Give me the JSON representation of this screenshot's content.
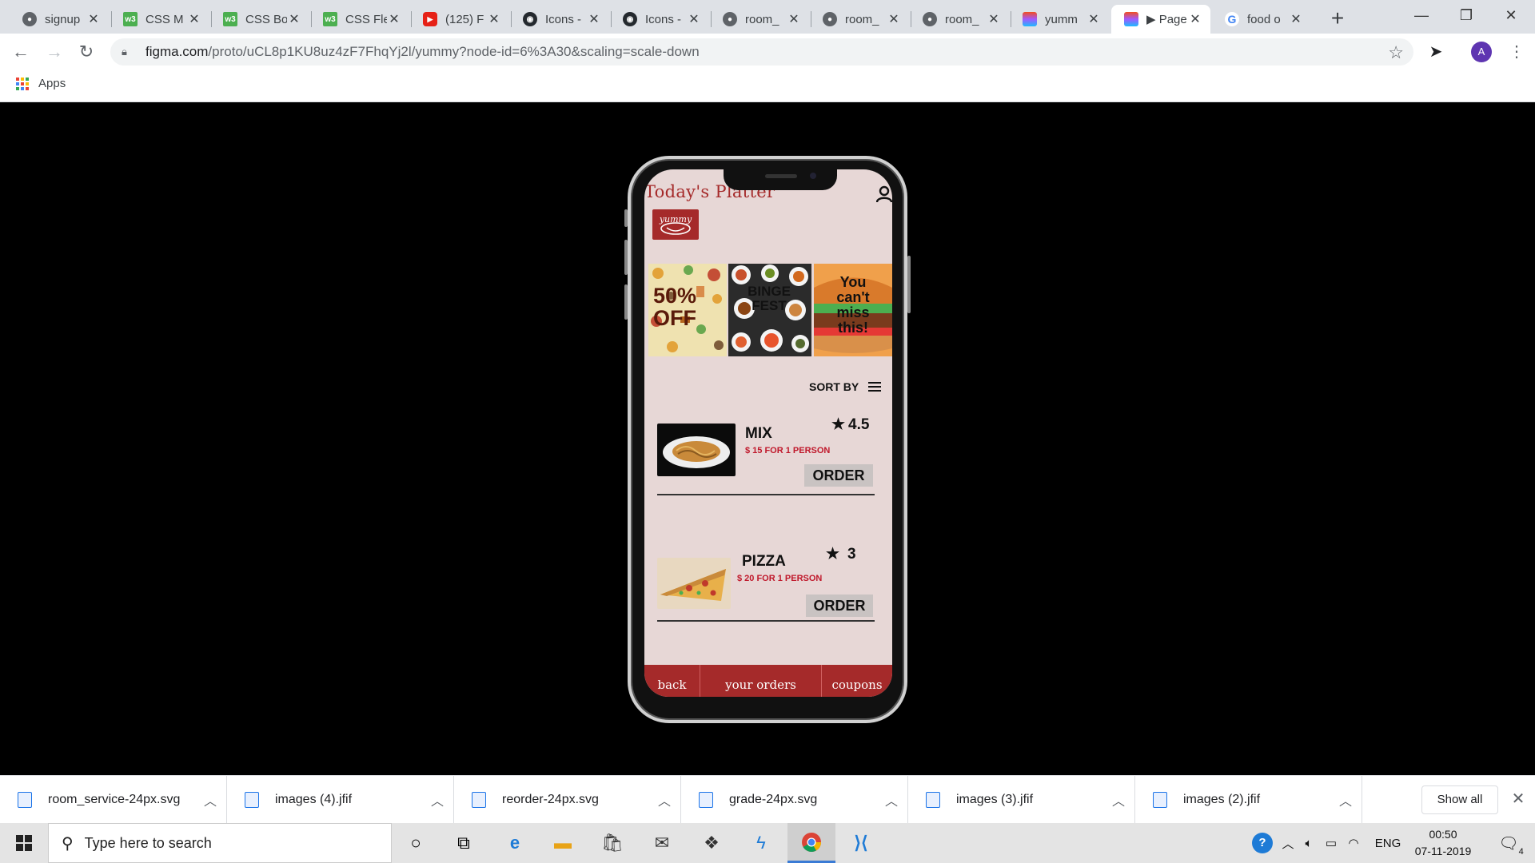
{
  "browser": {
    "tabs": [
      {
        "title": "signup",
        "icon": "globe-icon",
        "active": false
      },
      {
        "title": "CSS M",
        "icon": "w3schools-icon",
        "active": false
      },
      {
        "title": "CSS Bo",
        "icon": "w3schools-icon",
        "active": false
      },
      {
        "title": "CSS Fle",
        "icon": "w3schools-icon",
        "active": false
      },
      {
        "title": "(125) F",
        "icon": "youtube-icon",
        "active": false
      },
      {
        "title": "Icons -",
        "icon": "github-icon",
        "active": false
      },
      {
        "title": "Icons -",
        "icon": "github-icon",
        "active": false
      },
      {
        "title": "room_",
        "icon": "globe-icon",
        "active": false
      },
      {
        "title": "room_",
        "icon": "globe-icon",
        "active": false
      },
      {
        "title": "room_",
        "icon": "globe-icon",
        "active": false
      },
      {
        "title": "yumm",
        "icon": "figma-icon",
        "active": false
      },
      {
        "title": "▶ Page",
        "icon": "figma-icon",
        "active": true
      },
      {
        "title": "food o",
        "icon": "google-icon",
        "active": false
      }
    ],
    "address": {
      "host": "figma.com",
      "path": "/proto/uCL8p1KU8uz4zF7FhqYj2l/yummy?node-id=6%3A30&scaling=scale-down"
    },
    "avatar_letter": "A",
    "bookmarks": {
      "apps_label": "Apps"
    }
  },
  "app": {
    "title": "Today's Platter",
    "logo_text": "yummy",
    "banners": [
      {
        "text": "50% OFF"
      },
      {
        "text": "BINGE FEST"
      },
      {
        "text": "You can't miss this!"
      }
    ],
    "sort_label": "SORT BY",
    "items": [
      {
        "name": "MIX",
        "price": "$ 15 FOR 1 PERSON",
        "rating": "4.5",
        "order_label": "ORDER"
      },
      {
        "name": "PIZZA",
        "price": "$ 20 FOR 1 PERSON",
        "rating": "3",
        "order_label": "ORDER"
      }
    ],
    "bottom_nav": [
      "back",
      "your orders",
      "coupons"
    ],
    "colors": {
      "accent": "#a52a2a",
      "price": "#c0182b",
      "screen_bg": "#e7d7d6"
    }
  },
  "downloads": {
    "files": [
      "room_service-24px.svg",
      "images (4).jfif",
      "reorder-24px.svg",
      "grade-24px.svg",
      "images (3).jfif",
      "images (2).jfif"
    ],
    "show_all": "Show all"
  },
  "taskbar": {
    "search_placeholder": "Type here to search",
    "language": "ENG",
    "time": "00:50",
    "date": "07-11-2019",
    "notification_count": "4"
  }
}
